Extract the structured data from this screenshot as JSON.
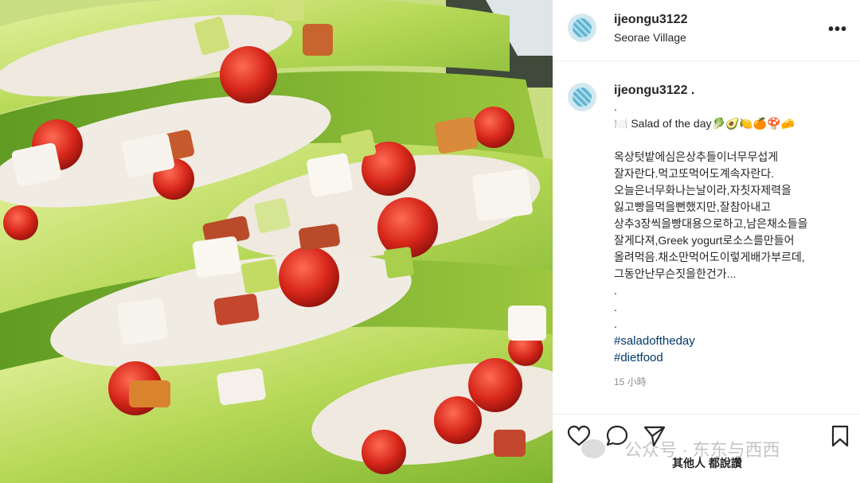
{
  "post": {
    "username": "ijeongu3122",
    "location": "Seorae Village",
    "more_icon": "more-horizontal-icon"
  },
  "caption": {
    "username": "ijeongu3122 .",
    "lines": [
      ".",
      "🍽️ Salad of the day🥬🥑🍋🍊🍄🧀",
      "",
      "옥상텃밭에심은상추들이너무무섭게",
      "잘자란다.먹고또먹어도계속자란다.",
      "오늘은너무화나는날이라,자칫자제력을",
      "잃고빵을먹을뻔했지만,잘참아내고",
      "상추3장씩을빵대용으로하고,남은채소들을",
      "잘게다져,Greek yogurt로소스를만들어",
      "올려먹음.채소만먹어도이렇게배가부르데,",
      "그동안난무슨짓을한건가...",
      ".",
      ".",
      "."
    ],
    "hashtags": [
      "#saladoftheday",
      "#dietfood"
    ],
    "time": "15 小時"
  },
  "actions": {
    "icons": [
      "heart-icon",
      "comment-icon",
      "share-icon",
      "bookmark-icon"
    ]
  },
  "watermark": {
    "text": "公众号 · 东东与西西"
  },
  "likes": {
    "text": "其他人 都說讚"
  }
}
